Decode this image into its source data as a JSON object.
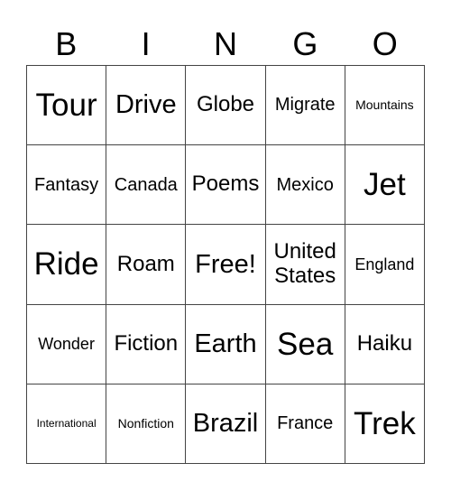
{
  "header": {
    "letters": [
      "B",
      "I",
      "N",
      "G",
      "O"
    ]
  },
  "cells": [
    [
      "Tour",
      "Drive",
      "Globe",
      "Migrate",
      "Mountains"
    ],
    [
      "Fantasy",
      "Canada",
      "Poems",
      "Mexico",
      "Jet"
    ],
    [
      "Ride",
      "Roam",
      "Free!",
      "United States",
      "England"
    ],
    [
      "Wonder",
      "Fiction",
      "Earth",
      "Sea",
      "Haiku"
    ],
    [
      "International",
      "Nonfiction",
      "Brazil",
      "France",
      "Trek"
    ]
  ]
}
